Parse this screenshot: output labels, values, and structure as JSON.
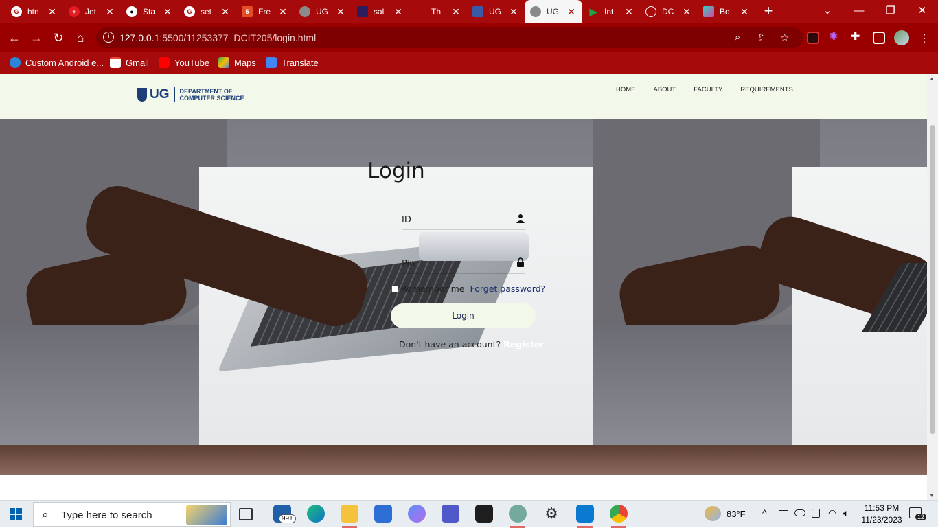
{
  "browser": {
    "tabs": [
      {
        "title": "htn",
        "icon": "google-icon"
      },
      {
        "title": "Jet",
        "icon": "jet-icon"
      },
      {
        "title": "Sta",
        "icon": "github-icon"
      },
      {
        "title": "set",
        "icon": "google-icon"
      },
      {
        "title": "Fre",
        "icon": "html-icon"
      },
      {
        "title": "UG",
        "icon": "globe-icon"
      },
      {
        "title": "sal",
        "icon": "shield-icon"
      },
      {
        "title": "Th",
        "icon": "blank-icon"
      },
      {
        "title": "UG",
        "icon": "ug-icon"
      },
      {
        "title": "UG",
        "icon": "globe-icon",
        "active": true
      },
      {
        "title": "Int",
        "icon": "play-icon"
      },
      {
        "title": "DC",
        "icon": "blank-icon"
      },
      {
        "title": "Bo",
        "icon": "cube-icon"
      }
    ],
    "url_host": "127.0.0.1",
    "url_path": ":5500/11253377_DCIT205/login.html",
    "bookmarks": [
      "Custom Android e...",
      "Gmail",
      "YouTube",
      "Maps",
      "Translate"
    ]
  },
  "site": {
    "logo_ug": "UG",
    "logo_dept_line1": "DEPARTMENT OF",
    "logo_dept_line2": "COMPUTER SCIENCE",
    "nav": [
      "HOME",
      "ABOUT",
      "FACULTY",
      "REQUIREMENTS"
    ]
  },
  "login": {
    "title": "Login",
    "id_placeholder": "ID",
    "pin_placeholder": "Pin",
    "remember": "Remember me",
    "forget": "Forget password?",
    "button": "Login",
    "no_account": "Don't have an account?",
    "register": "Register"
  },
  "taskbar": {
    "search_placeholder": "Type here to search",
    "mail_badge": "99+",
    "weather": "83°F",
    "time": "11:53 PM",
    "date": "11/23/2023",
    "notif_count": "12"
  },
  "colors": {
    "chrome_red": "#a70a0a",
    "header_bg": "#f3f9ea",
    "brand_navy": "#1c3d78"
  }
}
